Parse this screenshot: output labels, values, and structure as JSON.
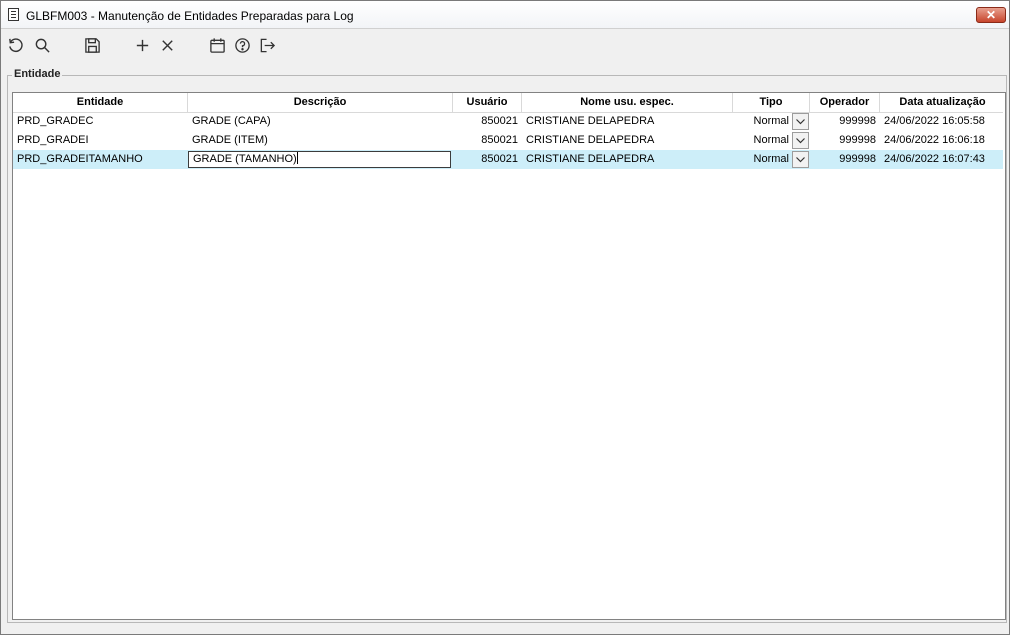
{
  "window": {
    "title": "GLBFM003 - Manutenção de Entidades Preparadas para Log",
    "close_label": "✕"
  },
  "toolbar": {
    "icons": [
      "refresh-icon",
      "search-icon",
      "save-icon",
      "add-icon",
      "delete-icon",
      "calendar-icon",
      "help-icon",
      "exit-icon"
    ]
  },
  "group": {
    "label": "Entidade"
  },
  "table": {
    "columns": [
      "Entidade",
      "Descrição",
      "Usuário",
      "Nome usu. espec.",
      "Tipo",
      "Operador",
      "Data atualização"
    ],
    "rows": [
      {
        "entidade": "PRD_GRADEC",
        "descricao": "GRADE (CAPA)",
        "usuario": "850021",
        "nome": "CRISTIANE DELAPEDRA",
        "tipo": "Normal",
        "operador": "999998",
        "data": "24/06/2022 16:05:58"
      },
      {
        "entidade": "PRD_GRADEI",
        "descricao": "GRADE (ITEM)",
        "usuario": "850021",
        "nome": "CRISTIANE DELAPEDRA",
        "tipo": "Normal",
        "operador": "999998",
        "data": "24/06/2022 16:06:18"
      },
      {
        "entidade": "PRD_GRADEITAMANHO",
        "descricao": "GRADE (TAMANHO)",
        "usuario": "850021",
        "nome": "CRISTIANE DELAPEDRA",
        "tipo": "Normal",
        "operador": "999998",
        "data": "24/06/2022 16:07:43",
        "selected": true
      }
    ]
  },
  "colors": {
    "selected_row": "#cdeef9",
    "close_button": "#c7452c"
  }
}
